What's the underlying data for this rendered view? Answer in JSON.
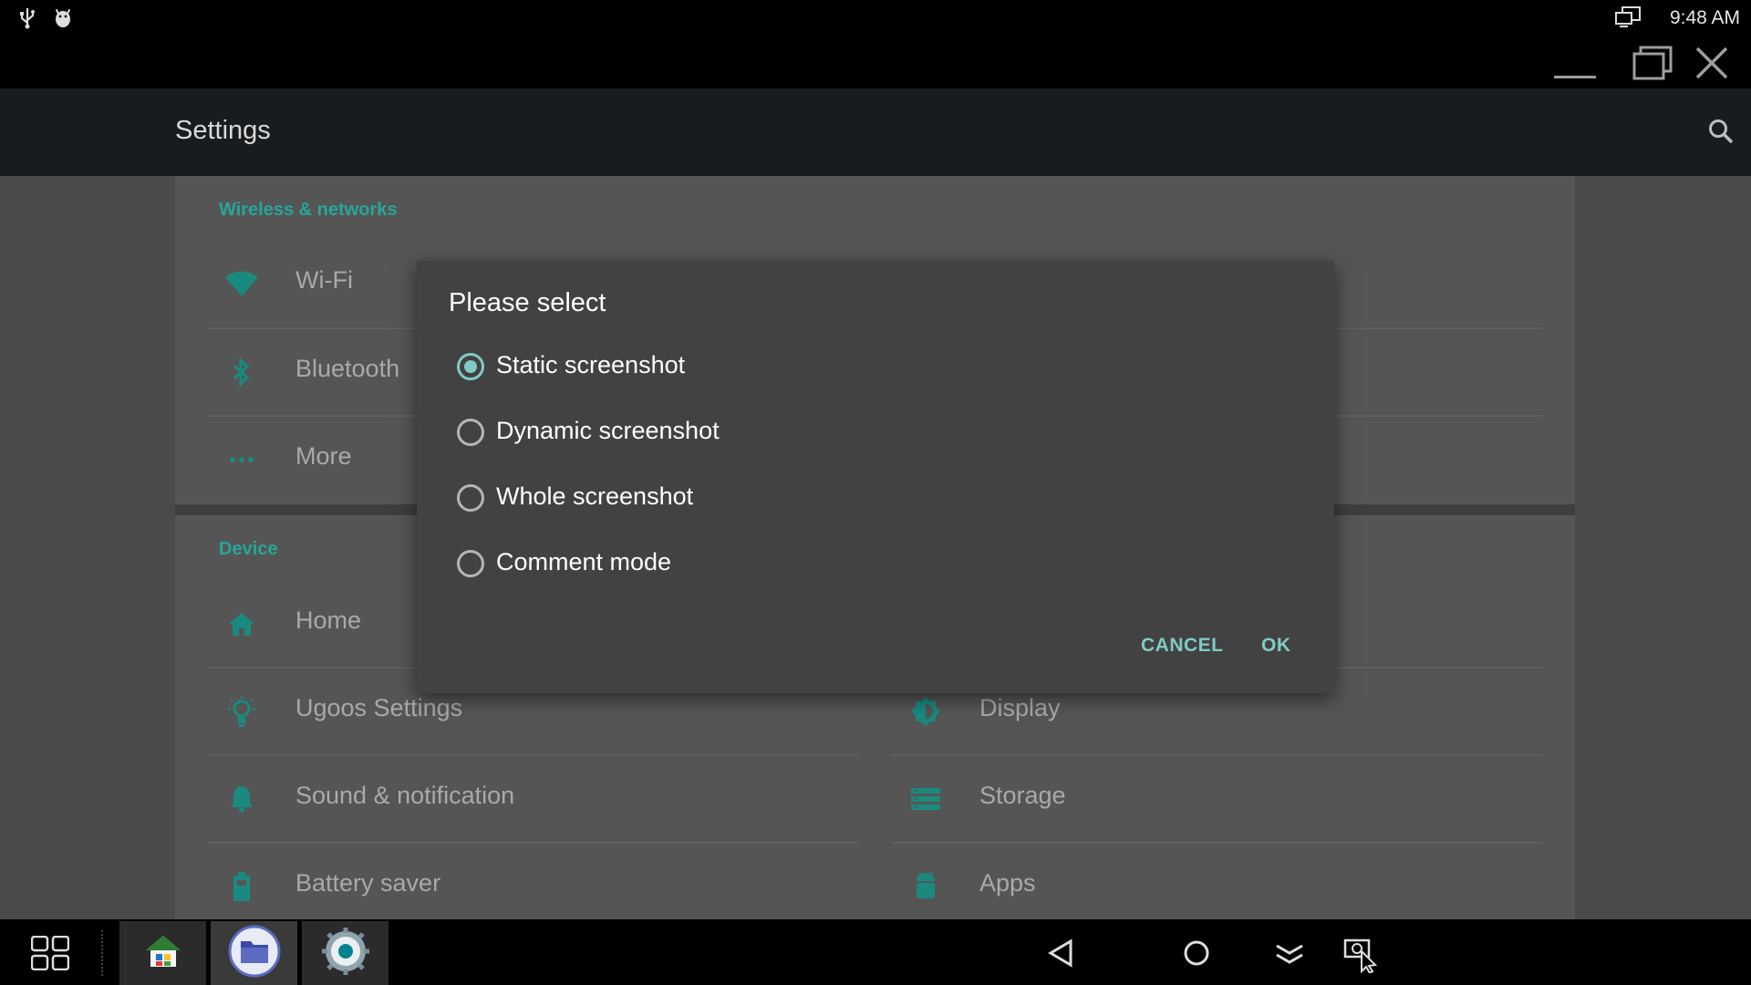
{
  "status_bar": {
    "time": "9:48 AM",
    "icons": [
      "usb-icon",
      "android-debug-icon",
      "screen-mirror-icon"
    ]
  },
  "window_controls": [
    "minimize-icon",
    "restore-icon",
    "close-icon"
  ],
  "app_bar": {
    "title": "Settings",
    "search_icon": "search-icon"
  },
  "sections": {
    "wireless": {
      "header": "Wireless & networks",
      "items": [
        {
          "label": "Wi-Fi",
          "icon": "wifi-icon"
        },
        {
          "label": "Bluetooth",
          "icon": "bluetooth-icon"
        },
        {
          "label": "More",
          "icon": "more-dots-icon"
        }
      ]
    },
    "device": {
      "header": "Device",
      "left_items": [
        {
          "label": "Home",
          "icon": "home-icon"
        },
        {
          "label": "Ugoos Settings",
          "icon": "lightbulb-icon"
        },
        {
          "label": "Sound & notification",
          "icon": "bell-icon"
        },
        {
          "label": "Battery saver",
          "icon": "battery-icon"
        }
      ],
      "right_items": [
        {
          "label": "Display",
          "icon": "brightness-icon"
        },
        {
          "label": "Storage",
          "icon": "storage-icon"
        },
        {
          "label": "Apps",
          "icon": "android-icon"
        }
      ]
    }
  },
  "dialog": {
    "title": "Please select",
    "options": [
      {
        "label": "Static screenshot",
        "checked": true
      },
      {
        "label": "Dynamic screenshot",
        "checked": false
      },
      {
        "label": "Whole screenshot",
        "checked": false
      },
      {
        "label": "Comment mode",
        "checked": false
      }
    ],
    "cancel_label": "CANCEL",
    "ok_label": "OK"
  },
  "taskbar": {
    "apps": [
      "home-launcher-icon",
      "file-manager-icon",
      "settings-app-icon"
    ],
    "nav": [
      "back-icon",
      "home-nav-icon",
      "notifications-icon",
      "screenshot-icon"
    ]
  },
  "colors": {
    "accent": "#80cbc4",
    "section_header": "#26a69a",
    "dialog_bg": "#424242"
  }
}
